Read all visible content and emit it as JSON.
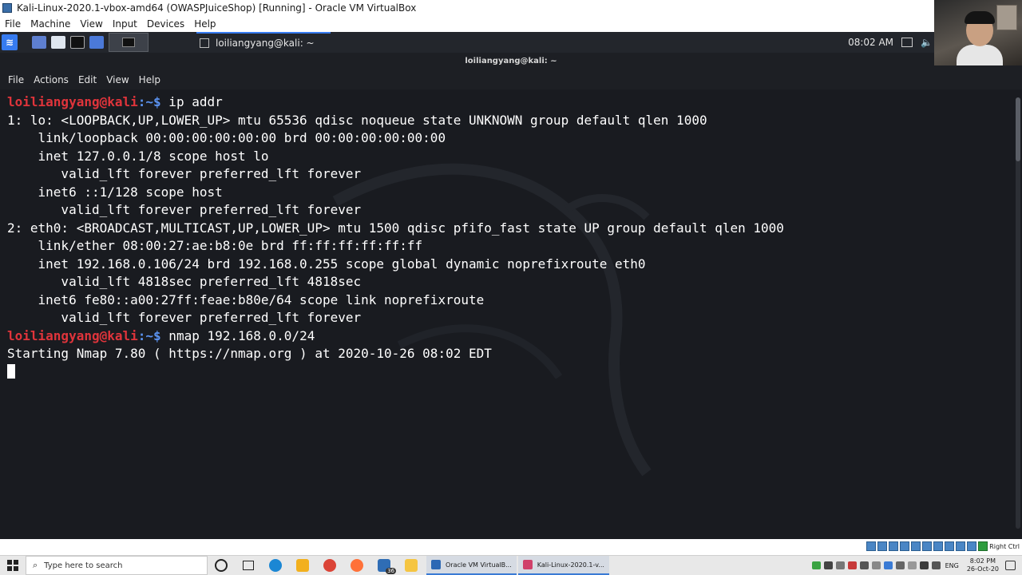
{
  "vbox_window": {
    "title": "Kali-Linux-2020.1-vbox-amd64 (OWASPJuiceShop) [Running] - Oracle VM VirtualBox",
    "menu": [
      "File",
      "Machine",
      "View",
      "Input",
      "Devices",
      "Help"
    ],
    "host_key": "Right Ctrl"
  },
  "kali_panel": {
    "task_title": "loiliangyang@kali: ~",
    "time": "08:02 AM"
  },
  "terminal": {
    "window_title": "loiliangyang@kali: ~",
    "menu": [
      "File",
      "Actions",
      "Edit",
      "View",
      "Help"
    ],
    "prompt_user": "loiliangyang@kali",
    "prompt_path": ":~$",
    "lines": [
      {
        "type": "prompt",
        "cmd": " ip addr"
      },
      {
        "type": "out",
        "text": "1: lo: <LOOPBACK,UP,LOWER_UP> mtu 65536 qdisc noqueue state UNKNOWN group default qlen 1000"
      },
      {
        "type": "out",
        "text": "    link/loopback 00:00:00:00:00:00 brd 00:00:00:00:00:00"
      },
      {
        "type": "out",
        "text": "    inet 127.0.0.1/8 scope host lo"
      },
      {
        "type": "out",
        "text": "       valid_lft forever preferred_lft forever"
      },
      {
        "type": "out",
        "text": "    inet6 ::1/128 scope host"
      },
      {
        "type": "out",
        "text": "       valid_lft forever preferred_lft forever"
      },
      {
        "type": "out",
        "text": "2: eth0: <BROADCAST,MULTICAST,UP,LOWER_UP> mtu 1500 qdisc pfifo_fast state UP group default qlen 1000"
      },
      {
        "type": "out",
        "text": "    link/ether 08:00:27:ae:b8:0e brd ff:ff:ff:ff:ff:ff"
      },
      {
        "type": "out",
        "text": "    inet 192.168.0.106/24 brd 192.168.0.255 scope global dynamic noprefixroute eth0"
      },
      {
        "type": "out",
        "text": "       valid_lft 4818sec preferred_lft 4818sec"
      },
      {
        "type": "out",
        "text": "    inet6 fe80::a00:27ff:feae:b80e/64 scope link noprefixroute"
      },
      {
        "type": "out",
        "text": "       valid_lft forever preferred_lft forever"
      },
      {
        "type": "prompt",
        "cmd": " nmap 192.168.0.0/24"
      },
      {
        "type": "out",
        "text": "Starting Nmap 7.80 ( https://nmap.org ) at 2020-10-26 08:02 EDT"
      },
      {
        "type": "cursor",
        "text": ""
      }
    ]
  },
  "windows_taskbar": {
    "search_placeholder": "Type here to search",
    "mail_badge": "36",
    "tasks": [
      "Oracle VM VirtualB...",
      "Kali-Linux-2020.1-v..."
    ],
    "language": "ENG",
    "time": "8:02 PM",
    "date": "26-Oct-20"
  },
  "colors": {
    "prompt_user": "#e0343b",
    "prompt_path": "#5b93f1",
    "kali_accent": "#367bf0"
  }
}
